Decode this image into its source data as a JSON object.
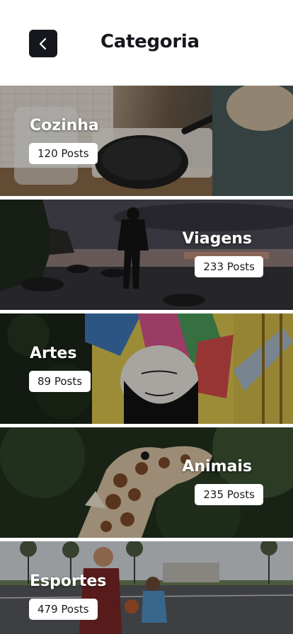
{
  "header": {
    "title": "Categoria"
  },
  "categories": [
    {
      "name": "Cozinha",
      "posts": "120 Posts"
    },
    {
      "name": "Viagens",
      "posts": "233 Posts"
    },
    {
      "name": "Artes",
      "posts": "89 Posts"
    },
    {
      "name": "Animais",
      "posts": "235 Posts"
    },
    {
      "name": "Esportes",
      "posts": "479 Posts"
    }
  ]
}
